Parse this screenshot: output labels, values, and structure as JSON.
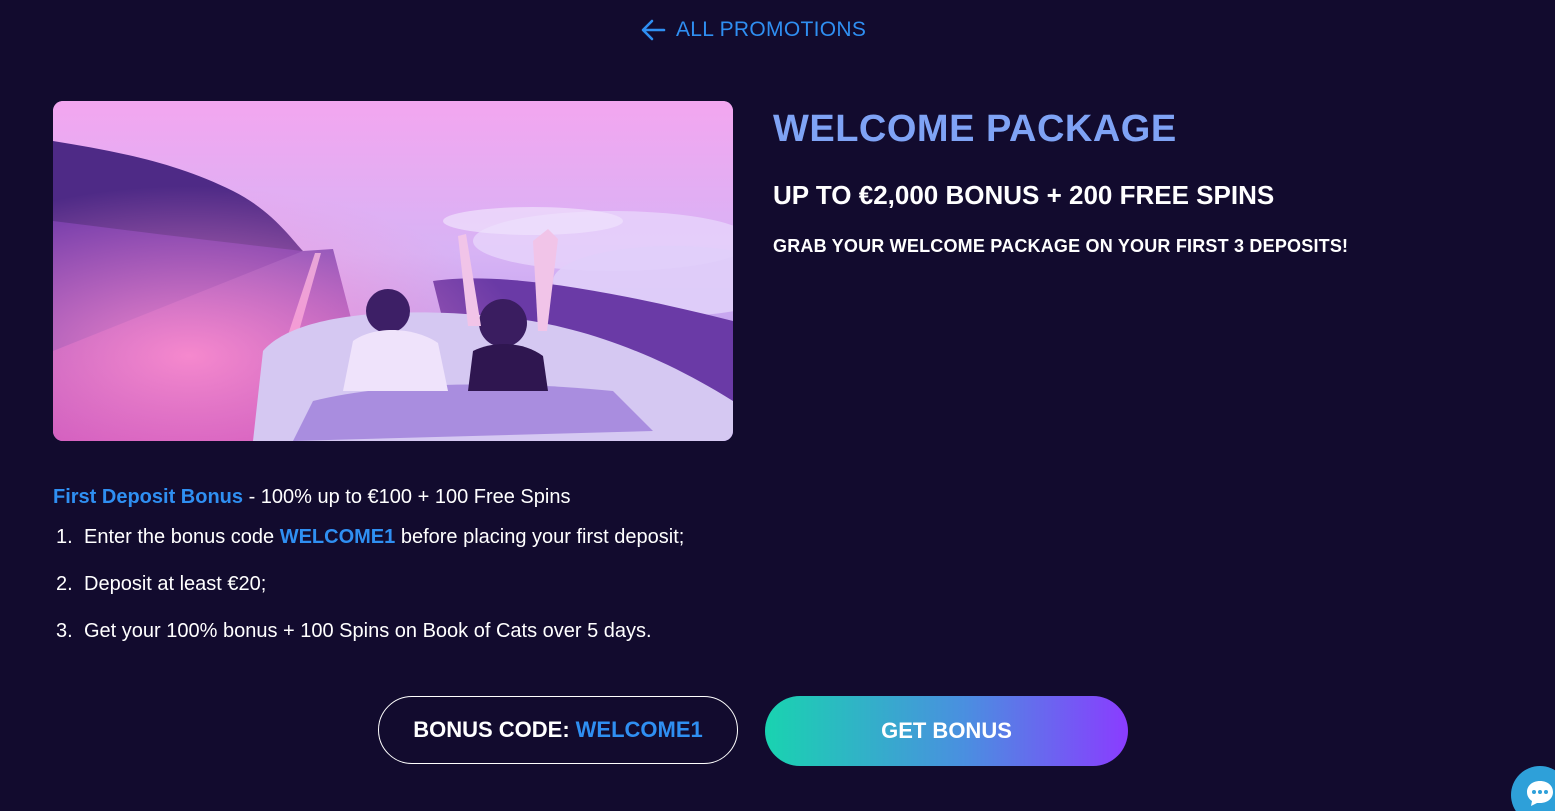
{
  "nav": {
    "back_label": "ALL PROMOTIONS",
    "back_icon": "arrow-left-icon"
  },
  "promo": {
    "title": "WELCOME PACKAGE",
    "subtitle": "UP TO €2,000 BONUS + 200 FREE SPINS",
    "tagline": "GRAB YOUR WELCOME PACKAGE ON YOUR FIRST 3 DEPOSITS!",
    "hero_image": "couple-in-convertible-sunset-image"
  },
  "details": {
    "heading": "First Deposit Bonus",
    "heading_rest": " - 100% up to €100 + 100 Free Spins",
    "steps": [
      {
        "num": "1.",
        "before": "Enter the bonus code ",
        "code": "WELCOME1",
        "after": " before placing your first deposit;"
      },
      {
        "num": "2.",
        "text": "Deposit at least €20;"
      },
      {
        "num": "3.",
        "text": "Get your 100% bonus + 100 Spins on Book of Cats over 5 days."
      }
    ]
  },
  "buttons": {
    "code_label": "BONUS CODE:",
    "code_value": "WELCOME1",
    "get_bonus_label": "GET BONUS"
  },
  "colors": {
    "background": "#120b2e",
    "accent_blue": "#2f8ff2",
    "title_blue": "#7fa3f5",
    "button_gradient_start": "#19d3b0",
    "button_gradient_end": "#8a3cff",
    "chat_button": "#2ea0d9"
  },
  "chat": {
    "icon": "chat-bubble-icon"
  }
}
